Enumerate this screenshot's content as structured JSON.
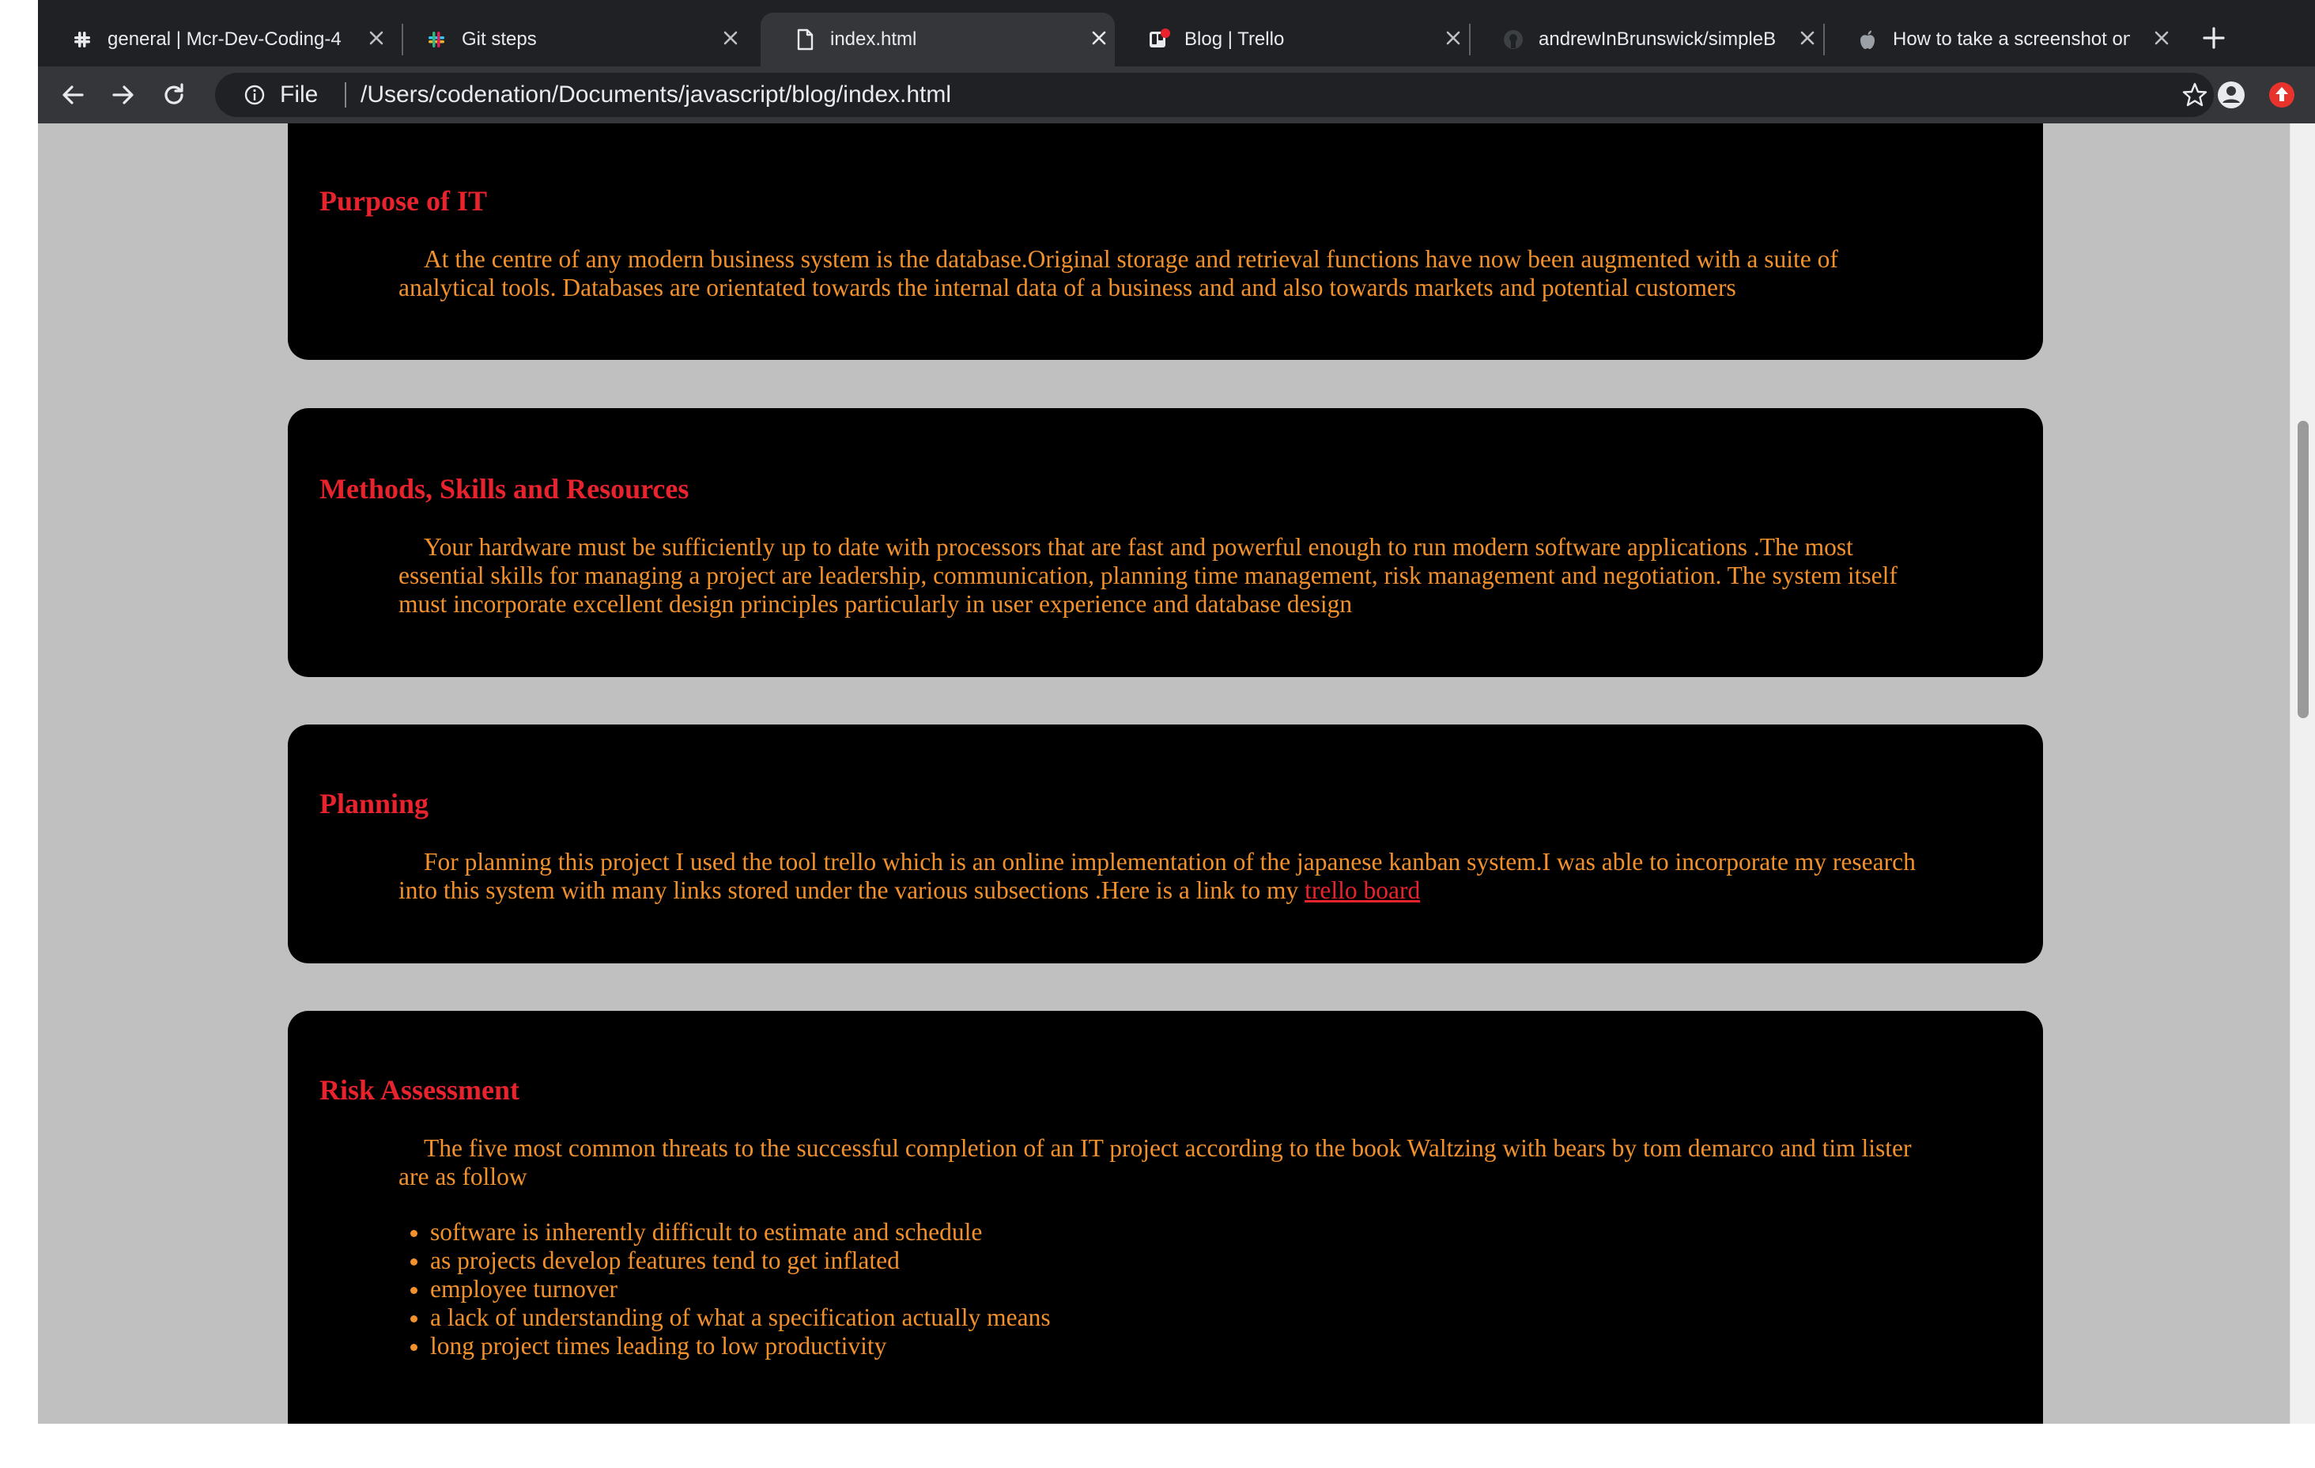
{
  "browser": {
    "tabs": [
      {
        "title": "general | Mcr-Dev-Coding-4",
        "icon": "slack-icon"
      },
      {
        "title": "Git steps",
        "icon": "slack-icon"
      },
      {
        "title": "index.html",
        "icon": "file-icon",
        "active": true
      },
      {
        "title": "Blog | Trello",
        "icon": "trello-icon"
      },
      {
        "title": "andrewInBrunswick/simpleB",
        "icon": "github-icon"
      },
      {
        "title": "How to take a screenshot on",
        "icon": "apple-icon"
      }
    ],
    "scheme_label": "File",
    "url": "/Users/codenation/Documents/javascript/blog/index.html"
  },
  "sections": [
    {
      "heading": "Purpose of IT",
      "body": "At the centre of any modern business system is the database.Original storage and retrieval functions have now been augmented with a suite of analytical tools. Databases are orientated towards the internal data of a business and and also towards markets and potential customers"
    },
    {
      "heading": "Methods, Skills and Resources",
      "body": "Your hardware must be sufficiently up to date with processors that are fast and powerful enough to run modern software applications .The most essential skills for managing a project are leadership, communication, planning time management, risk management and negotiation. The system itself must incorporate excellent design principles particularly in user experience and database design"
    },
    {
      "heading": "Planning",
      "body": "For planning this project I used the tool trello which is an online implementation of the japanese kanban system.I was able to incorporate my research into this system with many links stored under the various subsections .Here is a link to my",
      "link_text": "trello board"
    },
    {
      "heading": "Risk Assessment",
      "body": "The five most common threats to the successful completion of an IT project according to the book Waltzing with bears by tom demarco and tim lister are as follow",
      "items": [
        "software is inherently difficult to estimate and schedule",
        "as projects develop features tend to get inflated",
        "employee turnover",
        "a lack of understanding of what a specification actually means",
        "long project times leading to low productivity"
      ]
    }
  ],
  "colors": {
    "heading": "#e8232d",
    "body_text": "#f2912c",
    "card_background": "#000000",
    "page_background": "#c0c0c0",
    "tabstrip": "#202124",
    "toolbar": "#35363a"
  }
}
